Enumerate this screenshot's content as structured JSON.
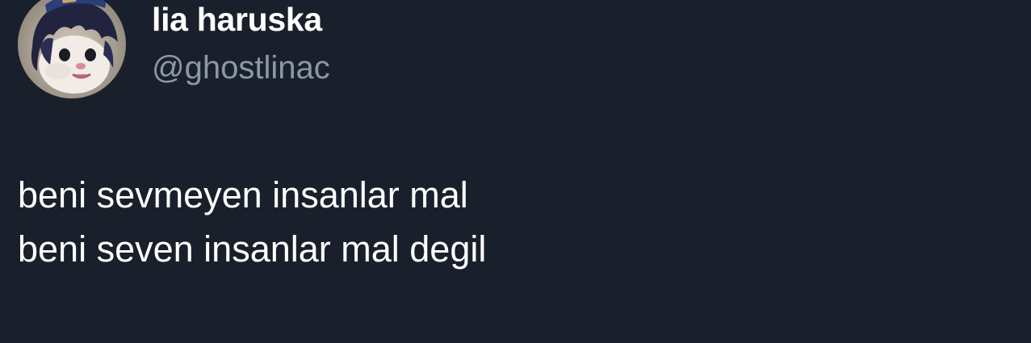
{
  "author": {
    "display_name": "lia haruska",
    "handle": "@ghostlinac",
    "avatar_icon": "cat-avatar-with-dark-hair"
  },
  "tweet": {
    "lines": [
      "beni sevmeyen insanlar mal",
      "beni seven insanlar mal degil"
    ]
  },
  "colors": {
    "background": "#1a202b",
    "text": "#ffffff",
    "muted": "#8b98a5"
  }
}
